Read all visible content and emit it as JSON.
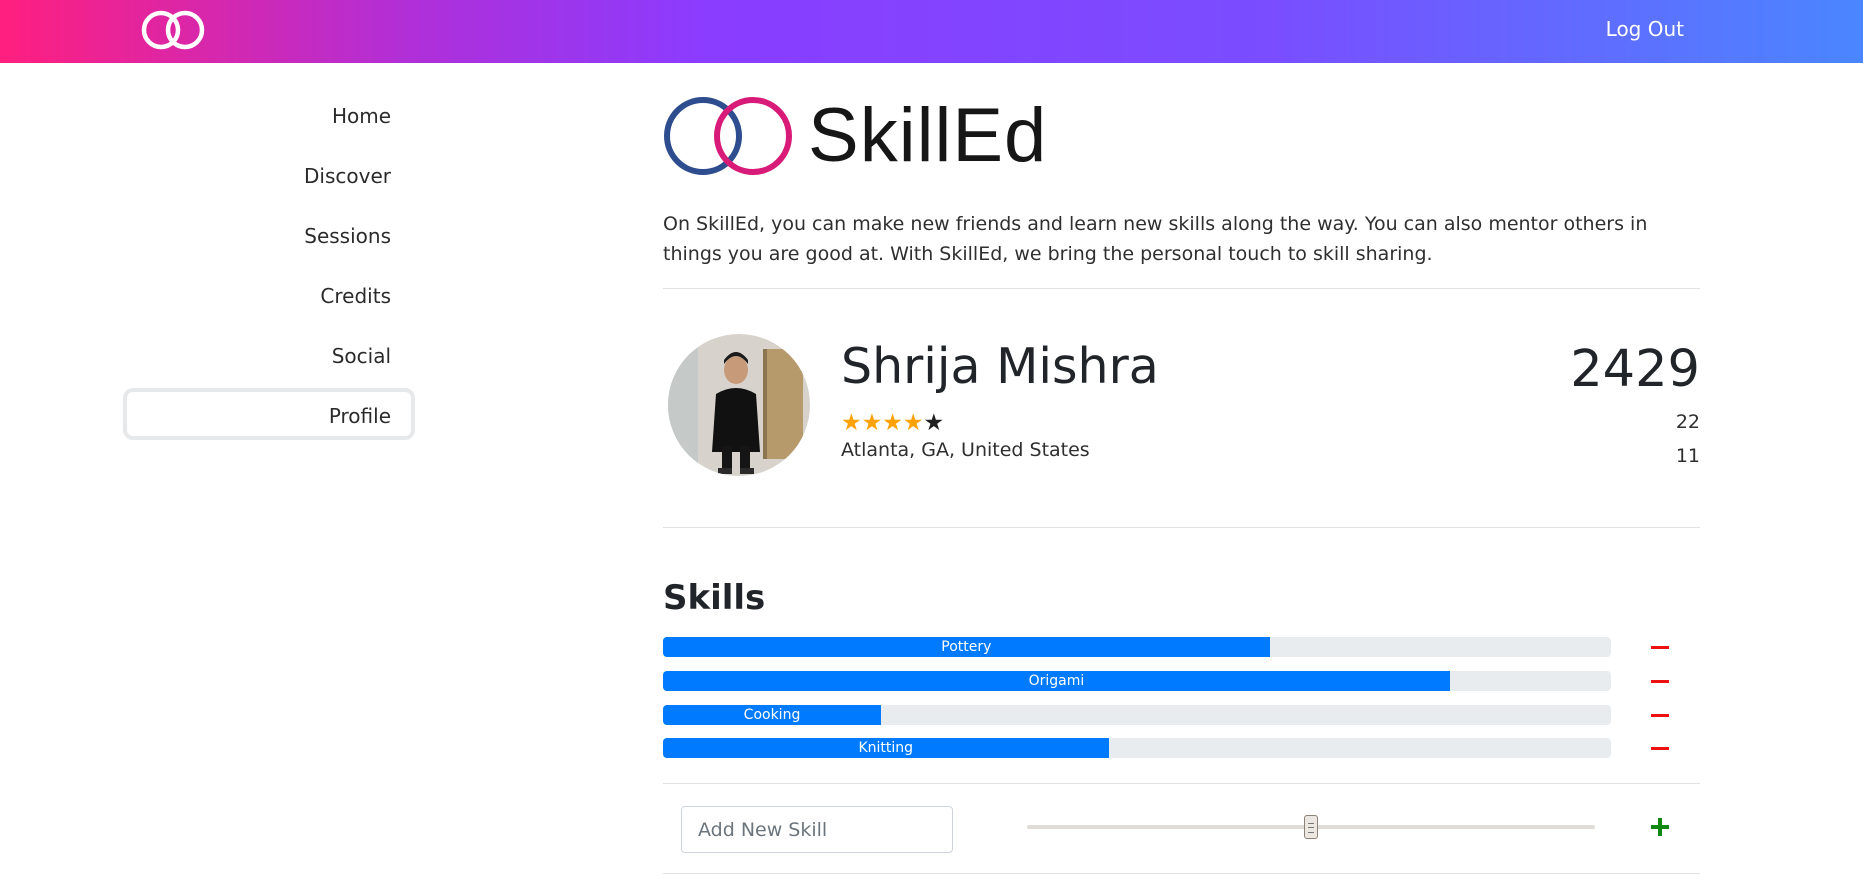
{
  "header": {
    "logout_label": "Log Out"
  },
  "sidebar": {
    "items": [
      {
        "label": "Home"
      },
      {
        "label": "Discover"
      },
      {
        "label": "Sessions"
      },
      {
        "label": "Credits"
      },
      {
        "label": "Social"
      },
      {
        "label": "Profile",
        "active": true
      }
    ]
  },
  "main": {
    "brand_name": "SkillEd",
    "intro": "On SkillEd, you can make new friends and learn new skills along the way. You can also mentor others in things you are good at. With SkillEd, we bring the personal touch to skill sharing."
  },
  "profile": {
    "name": "Shrija Mishra",
    "rating": 4,
    "rating_max": 5,
    "location": "Atlanta, GA, United States",
    "credits": "2429",
    "stat_1": "22",
    "stat_2": "11"
  },
  "skills": {
    "title": "Skills",
    "items": [
      {
        "name": "Pottery",
        "level": 0.64
      },
      {
        "name": "Origami",
        "level": 0.83
      },
      {
        "name": "Cooking",
        "level": 0.23
      },
      {
        "name": "Knitting",
        "level": 0.47
      }
    ],
    "new_skill_placeholder": "Add New Skill",
    "new_skill_level": 0.5
  },
  "colors": {
    "header_gradient_start": "#ff1f7e",
    "header_gradient_end": "#4a86ff",
    "progress_fill": "#007bff",
    "remove_icon": "#ee1111",
    "add_icon": "#118811",
    "star_filled": "#ffa200",
    "logo_ring_blue": "#2e4d8f",
    "logo_ring_pink": "#d81b78"
  },
  "icons": {
    "header_logo": "two-rings-logo-icon",
    "remove": "minus-icon",
    "add": "plus-icon",
    "star": "star-icon"
  }
}
